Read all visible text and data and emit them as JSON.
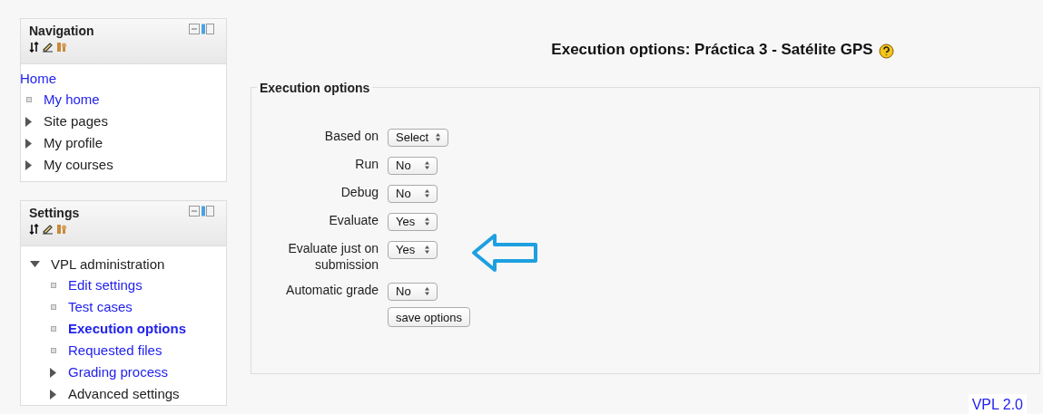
{
  "blocks": [
    {
      "title": "Navigation",
      "items": [
        {
          "label": "Home",
          "kind": "link",
          "children": [
            {
              "label": "My home",
              "kind": "leaf",
              "link": true
            },
            {
              "label": "Site pages",
              "kind": "branch",
              "expanded": false,
              "link": false
            },
            {
              "label": "My profile",
              "kind": "branch",
              "expanded": false,
              "link": false
            },
            {
              "label": "My courses",
              "kind": "branch",
              "expanded": false,
              "link": false
            }
          ]
        }
      ]
    },
    {
      "title": "Settings",
      "items": [
        {
          "label": "VPL administration",
          "kind": "branch",
          "expanded": true,
          "link": false,
          "children": [
            {
              "label": "Edit settings",
              "kind": "leaf",
              "link": true,
              "selected": false
            },
            {
              "label": "Test cases",
              "kind": "leaf",
              "link": true,
              "selected": false
            },
            {
              "label": "Execution options",
              "kind": "leaf",
              "link": true,
              "selected": true
            },
            {
              "label": "Requested files",
              "kind": "leaf",
              "link": true,
              "selected": false
            },
            {
              "label": "Grading process",
              "kind": "branch",
              "expanded": false,
              "link": true,
              "selected": false
            },
            {
              "label": "Advanced settings",
              "kind": "branch",
              "expanded": false,
              "link": false,
              "selected": false
            }
          ]
        }
      ]
    }
  ],
  "page_title": "Execution options: Práctica 3 - Satélite GPS",
  "form": {
    "legend": "Execution options",
    "fields": [
      {
        "label": "Based on",
        "value": "Select"
      },
      {
        "label": "Run",
        "value": "No"
      },
      {
        "label": "Debug",
        "value": "No"
      },
      {
        "label": "Evaluate",
        "value": "Yes"
      },
      {
        "label": "Evaluate just on submission",
        "value": "Yes"
      },
      {
        "label": "Automatic grade",
        "value": "No"
      }
    ],
    "button": "save options"
  },
  "footer_link": "VPL 2.0"
}
